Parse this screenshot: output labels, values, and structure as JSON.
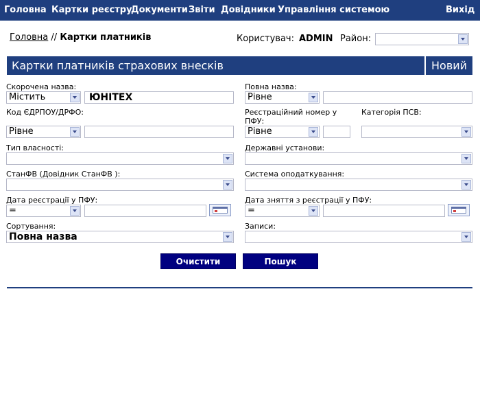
{
  "nav": {
    "items": [
      "Головна",
      "Картки реєстру",
      "Документи",
      "Звіти",
      "Довідники",
      "Управління системою"
    ],
    "logout": "Вихід"
  },
  "breadcrumb": {
    "home": "Головна",
    "separator": "//",
    "current": "Картки платників"
  },
  "user": {
    "label": "Користувач:",
    "name": "ADMIN",
    "district_label": "Район:",
    "district_value": ""
  },
  "banner": {
    "title": "Картки платників страхових внесків",
    "new_label": "Новий"
  },
  "form": {
    "short_name": {
      "label": "Скорочена назва:",
      "operator": "Містить",
      "value": "ЮНІТЕХ"
    },
    "full_name": {
      "label": "Повна назва:",
      "operator": "Рівне",
      "value": ""
    },
    "edrpou": {
      "label": "Код ЄДРПОУ/ДРФО:",
      "operator": "Рівне",
      "value": ""
    },
    "pfu_reg": {
      "label_line1": "Реєстраційний номер у",
      "label_line2": "ПФУ:",
      "operator": "Рівне",
      "value": ""
    },
    "psv_category": {
      "label": "Категорія ПСВ:",
      "value": ""
    },
    "ownership": {
      "label": "Тип власності:",
      "value": ""
    },
    "state_institutions": {
      "label": "Державні установи:",
      "value": ""
    },
    "stanfv": {
      "label": "СтанФВ (Довідник СтанФВ ):",
      "value": ""
    },
    "tax_system": {
      "label": "Система оподаткування:",
      "value": ""
    },
    "reg_date": {
      "label": "Дата реєстрації у ПФУ:",
      "operator": "=",
      "value": ""
    },
    "unreg_date": {
      "label": "Дата зняття з реєстрації у ПФУ:",
      "operator": "=",
      "value": ""
    },
    "sorting": {
      "label": "Сортування:",
      "value": "Повна назва"
    },
    "records": {
      "label": "Записи:",
      "value": ""
    }
  },
  "buttons": {
    "clear": "Очистити",
    "search": "Пошук"
  },
  "colors": {
    "primary": "#1f3f7f",
    "button": "#000080"
  }
}
